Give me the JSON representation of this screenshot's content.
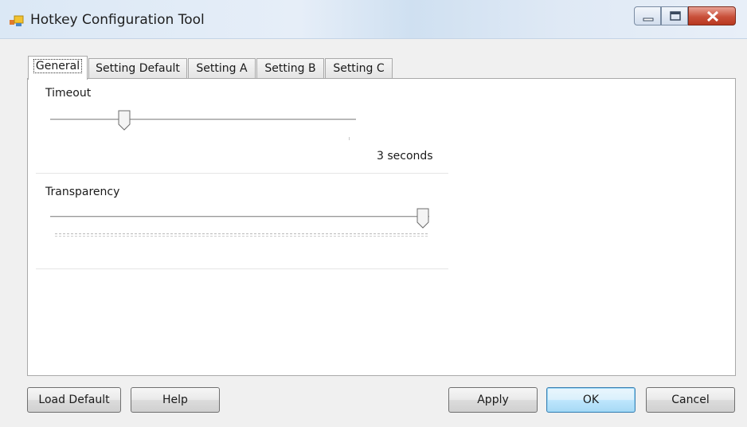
{
  "window": {
    "title": "Hotkey Configuration Tool",
    "icon": "app-window-icon",
    "controls": [
      "minimize-icon",
      "maximize-icon",
      "close-icon"
    ]
  },
  "tabs": [
    {
      "label": "General",
      "active": true
    },
    {
      "label": "Setting Default",
      "active": false
    },
    {
      "label": "Setting A",
      "active": false
    },
    {
      "label": "Setting B",
      "active": false
    },
    {
      "label": "Setting C",
      "active": false
    }
  ],
  "general": {
    "timeout": {
      "label": "Timeout",
      "value_text": "3 seconds",
      "level": 0.23
    },
    "transparency": {
      "label": "Transparency",
      "level": 1.0
    }
  },
  "buttons": {
    "load_default": "Load Default",
    "help": "Help",
    "apply": "Apply",
    "ok": "OK",
    "cancel": "Cancel"
  },
  "colors": {
    "accent": "#3c7fb1",
    "close_button": "#c9503a",
    "panel_bg": "#ffffff",
    "window_bg": "#f0f0f0"
  }
}
